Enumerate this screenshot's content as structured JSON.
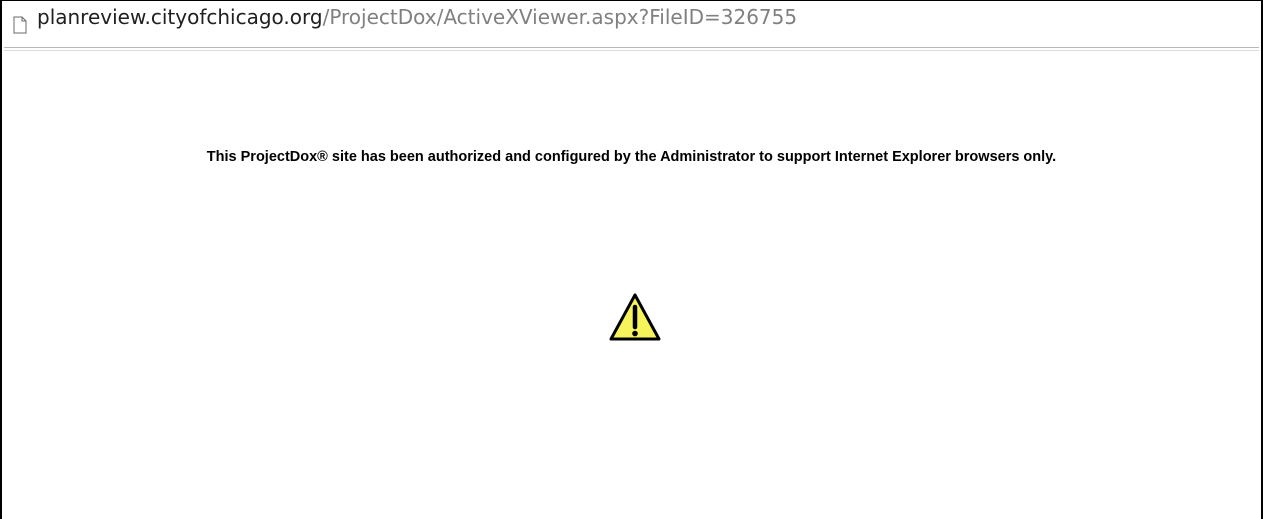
{
  "address_bar": {
    "page_icon": "page-icon",
    "host": "planreview.cityofchicago.org",
    "path": "/ProjectDox/ActiveXViewer.aspx?FileID=326755"
  },
  "main": {
    "message": "This ProjectDox® site has been authorized and configured by the Administrator to support Internet Explorer browsers only.",
    "icon": "warning-icon",
    "colors": {
      "warning_fill": "#f7f35a",
      "warning_stroke": "#000000"
    }
  }
}
